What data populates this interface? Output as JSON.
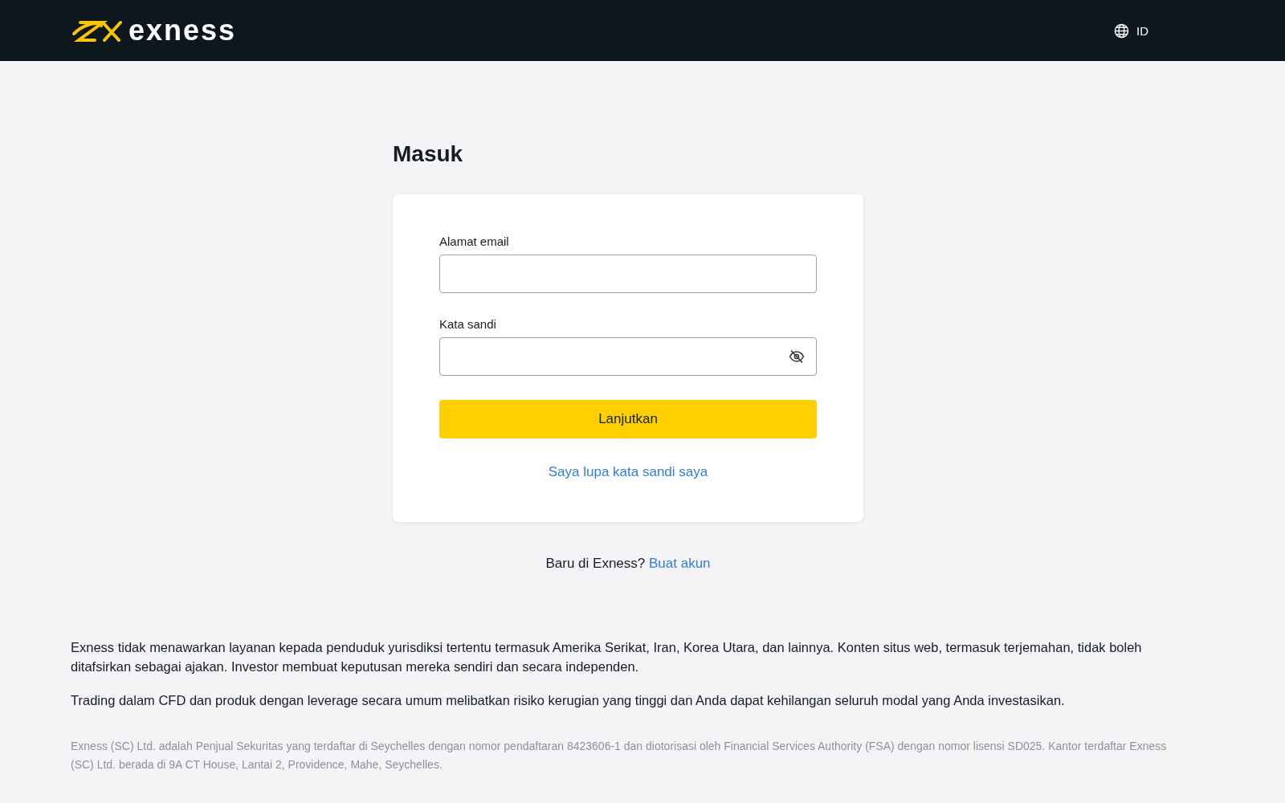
{
  "header": {
    "logo_text": "exness",
    "language": "ID"
  },
  "page_title": "Masuk",
  "form": {
    "fields": [
      {
        "label": "Alamat email",
        "kind": "email"
      },
      {
        "label": "Kata sandi",
        "kind": "password"
      }
    ],
    "submit": "Lanjutkan",
    "forgot_link": "Saya lupa kata sandi saya"
  },
  "signup": {
    "prompt": "Baru di Exness?",
    "link": "Buat akun"
  },
  "disclaimers": [
    "Exness tidak menawarkan layanan kepada penduduk yurisdiksi tertentu termasuk Amerika Serikat, Iran, Korea Utara, dan lainnya. Konten situs web, termasuk terjemahan, tidak boleh ditafsirkan sebagai ajakan. Investor membuat keputusan mereka sendiri dan secara independen.",
    "Trading dalam CFD dan produk dengan leverage secara umum melibatkan risiko kerugian yang tinggi dan Anda dapat kehilangan seluruh modal yang Anda investasikan."
  ],
  "legal": "Exness (SC) Ltd. adalah Penjual Sekuritas yang terdaftar di Seychelles dengan nomor pendaftaran 8423606-1 dan diotorisasi oleh Financial Services Authority (FSA) dengan nomor lisensi SD025. Kantor terdaftar Exness (SC) Ltd. berada di 9A CT House, Lantai 2, Providence, Mahe, Seychelles."
}
